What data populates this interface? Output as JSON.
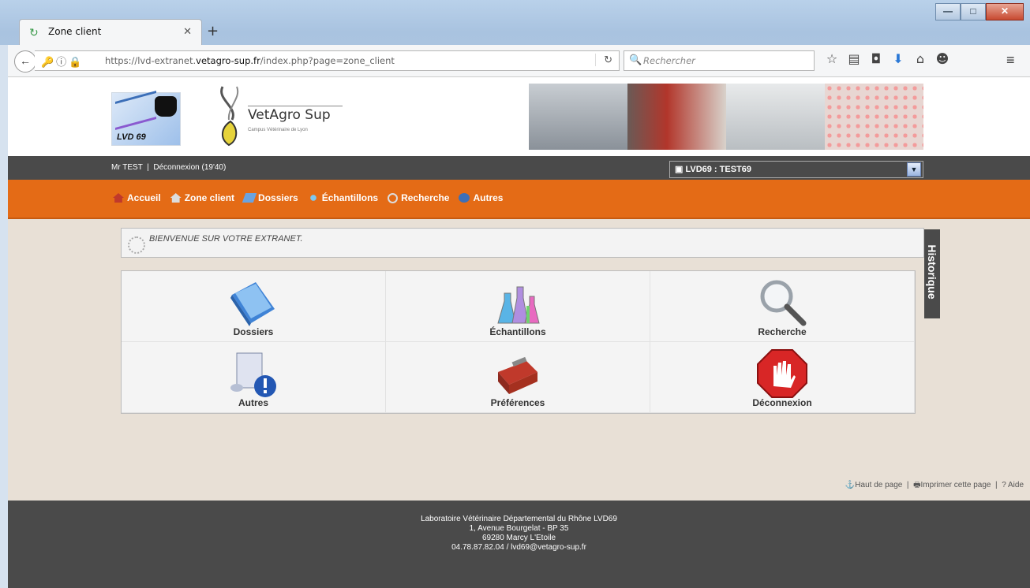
{
  "browser": {
    "tab_title": "Zone client",
    "url_prefix": "https://lvd-extranet.",
    "url_domain": "vetagro-sup.fr",
    "url_suffix": "/index.php?page=zone_client",
    "search_placeholder": "Rechercher",
    "icons": [
      "bookmark-star-icon",
      "reading-list-icon",
      "pocket-icon",
      "download-icon",
      "home-icon",
      "chat-icon",
      "hamburger-menu-icon"
    ]
  },
  "header": {
    "lvd_logo_text": "LVD 69",
    "vetagro_name": "VetAgro Sup",
    "vetagro_sub": "Campus Vétérinaire de Lyon"
  },
  "topbar": {
    "user": "Mr TEST",
    "logout": "Déconnexion (19'40)",
    "client_select": "LVD69 : TEST69"
  },
  "nav": {
    "items": [
      {
        "label": "Accueil"
      },
      {
        "label": "Zone client"
      },
      {
        "label": "Dossiers"
      },
      {
        "label": "Échantillons"
      },
      {
        "label": "Recherche"
      },
      {
        "label": "Autres"
      }
    ]
  },
  "welcome": "BIENVENUE SUR VOTRE EXTRANET.",
  "historique": "Historique",
  "tiles": [
    {
      "label": "Dossiers"
    },
    {
      "label": "Échantillons"
    },
    {
      "label": "Recherche"
    },
    {
      "label": "Autres"
    },
    {
      "label": "Préférences"
    },
    {
      "label": "Déconnexion"
    }
  ],
  "footer_links": {
    "top": "Haut de page",
    "print": "Imprimer cette page",
    "help": "Aide"
  },
  "footer": {
    "line1": "Laboratoire Vétérinaire Départemental du Rhône LVD69",
    "line2": "1, Avenue Bourgelat - BP 35",
    "line3": "69280 Marcy L'Etoile",
    "line4": "04.78.87.82.04 / lvd69@vetagro-sup.fr"
  },
  "colors": {
    "orange": "#e46b16",
    "dark": "#4a4a4a",
    "background": "#e8e0d6"
  }
}
